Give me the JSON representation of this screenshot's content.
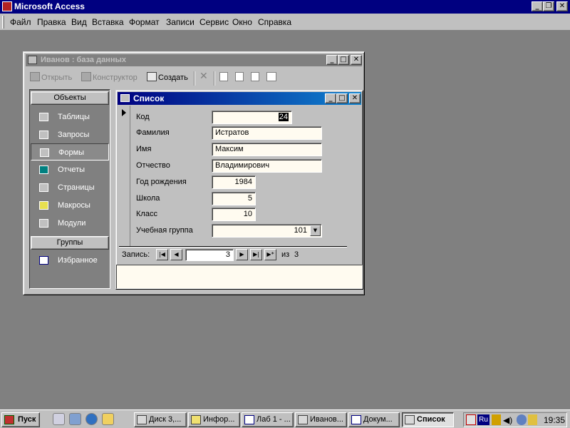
{
  "app": {
    "title": "Microsoft Access"
  },
  "menu": [
    "Файл",
    "Правка",
    "Вид",
    "Вставка",
    "Формат",
    "Записи",
    "Сервис",
    "Окно",
    "Справка"
  ],
  "db_window": {
    "title": "Иванов : база данных",
    "toolbar": {
      "open": "Открыть",
      "design": "Конструктор",
      "create": "Создать"
    },
    "objects_header": "Объекты",
    "objects": [
      "Таблицы",
      "Запросы",
      "Формы",
      "Отчеты",
      "Страницы",
      "Макросы",
      "Модули"
    ],
    "selected_object": "Формы",
    "groups_header": "Группы",
    "groups": [
      "Избранное"
    ]
  },
  "form": {
    "title": "Список",
    "fields": [
      {
        "label": "Код",
        "value": "24"
      },
      {
        "label": "Фамилия",
        "value": "Истратов"
      },
      {
        "label": "Имя",
        "value": "Максим"
      },
      {
        "label": "Отчество",
        "value": "Владимирович"
      },
      {
        "label": "Год рождения",
        "value": "1984"
      },
      {
        "label": "Школа",
        "value": "5"
      },
      {
        "label": "Класс",
        "value": "10"
      },
      {
        "label": "Учебная группа",
        "value": "101"
      }
    ],
    "nav": {
      "label": "Запись:",
      "current": "3",
      "of_label": "из",
      "total": "3"
    }
  },
  "taskbar": {
    "start": "Пуск",
    "buttons": [
      "Диск 3,...",
      "Инфор...",
      "Лаб 1 - ...",
      "Иванов...",
      "Докум...",
      "Список"
    ],
    "active": "Список",
    "tray_lang": "Ru",
    "clock": "19:35"
  }
}
